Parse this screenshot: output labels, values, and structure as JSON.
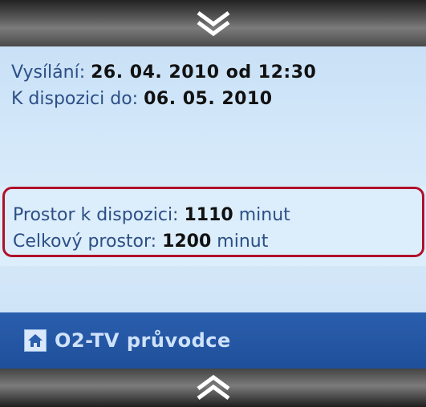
{
  "schedule": {
    "broadcast_label": "Vysílání:",
    "broadcast_value": "26. 04. 2010 od 12:30",
    "available_label": "K dispozici do:",
    "available_value": "06. 05. 2010"
  },
  "storage": {
    "free_label": "Prostor k dispozici:",
    "free_value": "1110",
    "free_unit": "minut",
    "total_label": "Celkový prostor:",
    "total_value": "1200",
    "total_unit": "minut"
  },
  "nav": {
    "home_label": "O2-TV průvodce"
  },
  "icons": {
    "scroll_down": "double-chevron-down-icon",
    "scroll_up": "double-chevron-up-icon",
    "home": "home-icon"
  },
  "colors": {
    "accent_blue": "#1f4f9a",
    "highlight_red": "#b0102a",
    "label_blue": "#2c4f86"
  }
}
